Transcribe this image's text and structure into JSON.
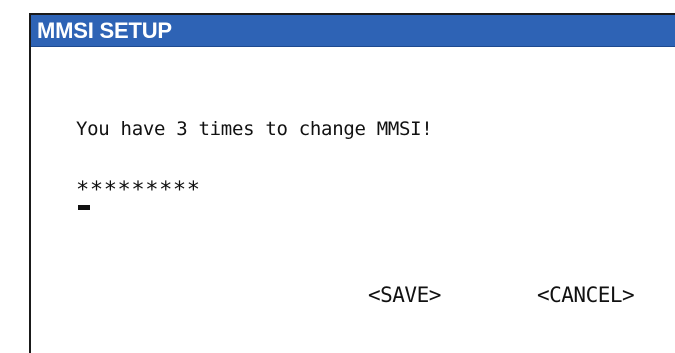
{
  "window": {
    "title": "MMSI SETUP"
  },
  "dialog": {
    "message": "You have 3 times to change MMSI!",
    "mmsi_masked": "*********"
  },
  "actions": {
    "save_label": "<SAVE>",
    "cancel_label": "<CANCEL>"
  },
  "colors": {
    "titlebar_bg": "#2e63b5",
    "title_text": "#ffffff",
    "body_text": "#111111",
    "background": "#ffffff"
  }
}
